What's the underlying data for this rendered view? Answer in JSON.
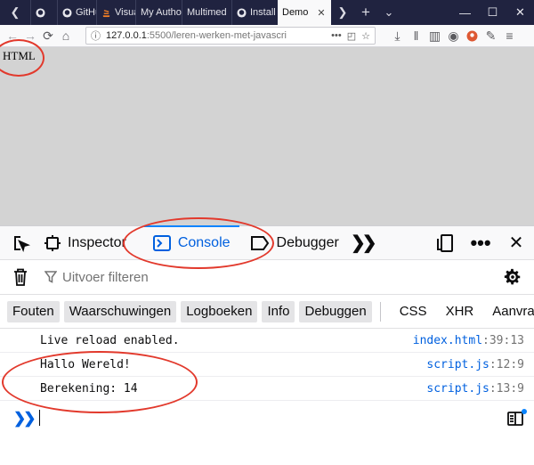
{
  "browser": {
    "tabs": [
      {
        "label": "",
        "icon": "github-icon"
      },
      {
        "label": "GitHu",
        "icon": "github-icon"
      },
      {
        "label": "Visual",
        "icon": "stackoverflow-icon"
      },
      {
        "label": "My Autho",
        "icon": "page-icon"
      },
      {
        "label": "Multimed",
        "icon": "page-icon"
      },
      {
        "label": "Install",
        "icon": "github-icon"
      },
      {
        "label": "Demo",
        "icon": "page-icon",
        "active": true
      }
    ],
    "url": {
      "host": "127.0.0.1",
      "rest": ":5500/leren-werken-met-javascri"
    }
  },
  "page": {
    "heading": "HTML"
  },
  "devtools": {
    "tabs": [
      {
        "label": "Inspector"
      },
      {
        "label": "Console",
        "active": true
      },
      {
        "label": "Debugger"
      }
    ],
    "filter_placeholder": "Uitvoer filteren",
    "levels": [
      "Fouten",
      "Waarschuwingen",
      "Logboeken",
      "Info",
      "Debuggen"
    ],
    "categories": [
      "CSS",
      "XHR",
      "Aanvragen"
    ],
    "messages": [
      {
        "text": "Live reload enabled.",
        "file": "index.html",
        "loc": ":39:13"
      },
      {
        "text": "Hallo Wereld!",
        "file": "script.js",
        "loc": ":12:9"
      },
      {
        "text": "Berekening: 14",
        "file": "script.js",
        "loc": ":13:9"
      }
    ]
  },
  "annotation_color": "#e2392c",
  "accent_color": "#0a84ff"
}
